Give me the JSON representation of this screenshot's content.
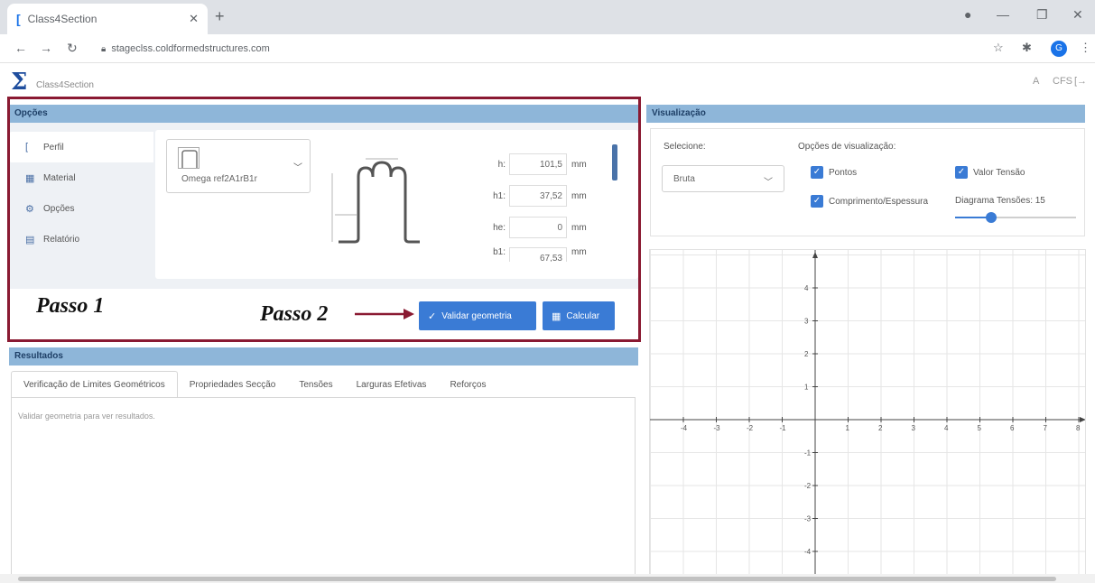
{
  "browser": {
    "tab_title": "Class4Section",
    "url": "stageclss.coldformedstructures.com"
  },
  "app": {
    "name": "Class4Section",
    "header_icons": {
      "user": "A",
      "cfs": "CFS",
      "logout": "[→"
    }
  },
  "opcoes": {
    "title": "Opções",
    "side_tabs": [
      {
        "label": "Perfil",
        "icon": "bracket-icon"
      },
      {
        "label": "Material",
        "icon": "material-icon"
      },
      {
        "label": "Opções",
        "icon": "gear-icon"
      },
      {
        "label": "Relatório",
        "icon": "document-icon"
      }
    ],
    "profile_select": "Omega ref2A1rB1r",
    "fields": [
      {
        "label": "h:",
        "value": "101,5",
        "unit": "mm"
      },
      {
        "label": "h1:",
        "value": "37,52",
        "unit": "mm"
      },
      {
        "label": "he:",
        "value": "0",
        "unit": "mm"
      },
      {
        "label": "b1:",
        "value": "67,53",
        "unit": "mm"
      }
    ]
  },
  "annotations": {
    "passo1": "Passo 1",
    "passo2": "Passo 2"
  },
  "buttons": {
    "validar": "Validar geometria",
    "calcular": "Calcular"
  },
  "resultados": {
    "title": "Resultados",
    "tabs": [
      "Verificação de Limites Geométricos",
      "Propriedades Secção",
      "Tensões",
      "Larguras Efetivas",
      "Reforços"
    ],
    "hint": "Validar geometria para ver resultados."
  },
  "visualizacao": {
    "title": "Visualização",
    "selecione_label": "Selecione:",
    "select_value": "Bruta",
    "options_label": "Opções de visualização:",
    "checkboxes": {
      "pontos": "Pontos",
      "valor_tensao": "Valor Tensão",
      "comprimento": "Comprimento/Espessura"
    },
    "diagram_label": "Diagrama Tensões: 15",
    "slider_fraction": 0.3,
    "axis": {
      "x_ticks": [
        -4,
        -3,
        -2,
        -1,
        1,
        2,
        3,
        4,
        5,
        6,
        7,
        8
      ],
      "y_ticks": [
        4,
        3,
        2,
        1,
        -1,
        -2,
        -3,
        -4
      ]
    }
  }
}
